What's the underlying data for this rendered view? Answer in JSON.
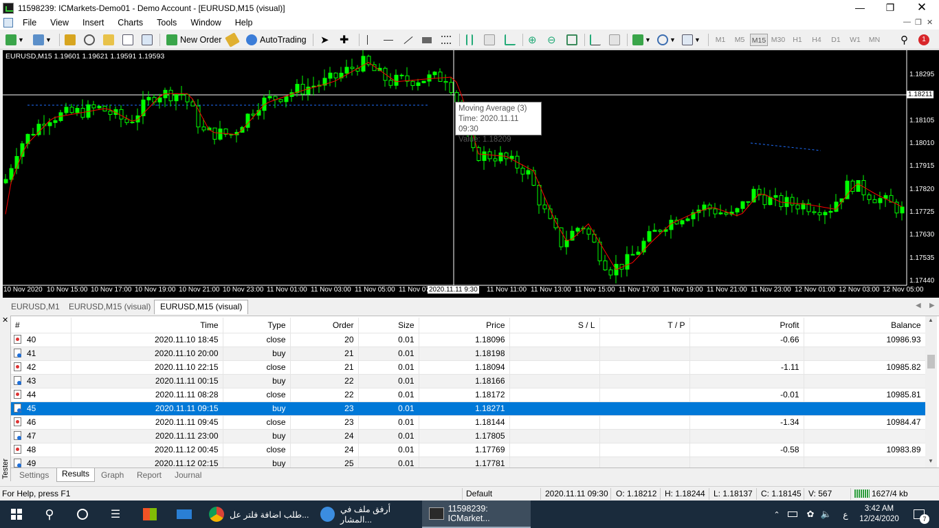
{
  "window": {
    "title": "11598239: ICMarkets-Demo01 - Demo Account - [EURUSD,M15 (visual)]"
  },
  "menu": [
    "File",
    "View",
    "Insert",
    "Charts",
    "Tools",
    "Window",
    "Help"
  ],
  "toolbar": {
    "new_order": "New Order",
    "autotrading": "AutoTrading",
    "timeframes": [
      "M1",
      "M5",
      "M15",
      "M30",
      "H1",
      "H4",
      "D1",
      "W1",
      "MN"
    ],
    "active_timeframe": "M15",
    "notification_count": "1"
  },
  "chart": {
    "info_line": "EURUSD,M15  1.19601 1.19621 1.19591 1.19593",
    "price_labels": [
      "1.18295",
      "1.18211",
      "1.18105",
      "1.18010",
      "1.17915",
      "1.17820",
      "1.17725",
      "1.17630",
      "1.17535",
      "1.17440"
    ],
    "crosshair_price": "1.18211",
    "time_labels": [
      "10 Nov 2020",
      "10 Nov 15:00",
      "10 Nov 17:00",
      "10 Nov 19:00",
      "10 Nov 21:00",
      "10 Nov 23:00",
      "11 Nov 01:00",
      "11 Nov 03:00",
      "11 Nov 05:00",
      "11 Nov 07",
      "11 Nov 11:00",
      "11 Nov 13:00",
      "11 Nov 15:00",
      "11 Nov 17:00",
      "11 Nov 19:00",
      "11 Nov 21:00",
      "11 Nov 23:00",
      "12 Nov 01:00",
      "12 Nov 03:00",
      "12 Nov 05:00"
    ],
    "crosshair_time": "2020.11.11 9:30",
    "tooltip": {
      "line1": "Moving Average (3)",
      "line2": "Time: 2020.11.11 09:30",
      "line3": "Value: 1.18209"
    },
    "colors": {
      "background": "#000000",
      "candle": "#00ff00",
      "ma": "#ff0000",
      "trade_line": "#1e6fff"
    }
  },
  "chart_tabs": [
    "EURUSD,M1",
    "EURUSD,M15 (visual)",
    "EURUSD,M15 (visual)"
  ],
  "active_chart_tab": 2,
  "results": {
    "columns": [
      "#",
      "Time",
      "Type",
      "Order",
      "Size",
      "Price",
      "S / L",
      "T / P",
      "Profit",
      "Balance"
    ],
    "rows": [
      {
        "n": "40",
        "time": "2020.11.10 18:45",
        "type": "close",
        "order": "20",
        "size": "0.01",
        "price": "1.18096",
        "sl": "",
        "tp": "",
        "profit": "-0.66",
        "balance": "10986.93"
      },
      {
        "n": "41",
        "time": "2020.11.10 20:00",
        "type": "buy",
        "order": "21",
        "size": "0.01",
        "price": "1.18198",
        "sl": "",
        "tp": "",
        "profit": "",
        "balance": ""
      },
      {
        "n": "42",
        "time": "2020.11.10 22:15",
        "type": "close",
        "order": "21",
        "size": "0.01",
        "price": "1.18094",
        "sl": "",
        "tp": "",
        "profit": "-1.11",
        "balance": "10985.82"
      },
      {
        "n": "43",
        "time": "2020.11.11 00:15",
        "type": "buy",
        "order": "22",
        "size": "0.01",
        "price": "1.18166",
        "sl": "",
        "tp": "",
        "profit": "",
        "balance": ""
      },
      {
        "n": "44",
        "time": "2020.11.11 08:28",
        "type": "close",
        "order": "22",
        "size": "0.01",
        "price": "1.18172",
        "sl": "",
        "tp": "",
        "profit": "-0.01",
        "balance": "10985.81"
      },
      {
        "n": "45",
        "time": "2020.11.11 09:15",
        "type": "buy",
        "order": "23",
        "size": "0.01",
        "price": "1.18271",
        "sl": "",
        "tp": "",
        "profit": "",
        "balance": ""
      },
      {
        "n": "46",
        "time": "2020.11.11 09:45",
        "type": "close",
        "order": "23",
        "size": "0.01",
        "price": "1.18144",
        "sl": "",
        "tp": "",
        "profit": "-1.34",
        "balance": "10984.47"
      },
      {
        "n": "47",
        "time": "2020.11.11 23:00",
        "type": "buy",
        "order": "24",
        "size": "0.01",
        "price": "1.17805",
        "sl": "",
        "tp": "",
        "profit": "",
        "balance": ""
      },
      {
        "n": "48",
        "time": "2020.11.12 00:45",
        "type": "close",
        "order": "24",
        "size": "0.01",
        "price": "1.17769",
        "sl": "",
        "tp": "",
        "profit": "-0.58",
        "balance": "10983.89"
      },
      {
        "n": "49",
        "time": "2020.11.12 02:15",
        "type": "buy",
        "order": "25",
        "size": "0.01",
        "price": "1.17781",
        "sl": "",
        "tp": "",
        "profit": "",
        "balance": ""
      }
    ],
    "selected_row": 5
  },
  "tester": {
    "label": "Tester",
    "tabs": [
      "Settings",
      "Results",
      "Graph",
      "Report",
      "Journal"
    ],
    "active_tab": 1
  },
  "statusbar": {
    "help": "For Help, press F1",
    "profile": "Default",
    "datetime": "2020.11.11 09:30",
    "open": "O: 1.18212",
    "high": "H: 1.18244",
    "low": "L: 1.18137",
    "close": "C: 1.18145",
    "volume": "V: 567",
    "traffic": "1627/4 kb"
  },
  "taskbar": {
    "apps": [
      {
        "label": "طلب اضافة فلتر عل..."
      },
      {
        "label": "أرفق ملف في المشار..."
      },
      {
        "label": "11598239: ICMarket..."
      }
    ],
    "lang": "ع",
    "time": "3:42 AM",
    "date": "12/24/2020",
    "notifications": "7"
  }
}
